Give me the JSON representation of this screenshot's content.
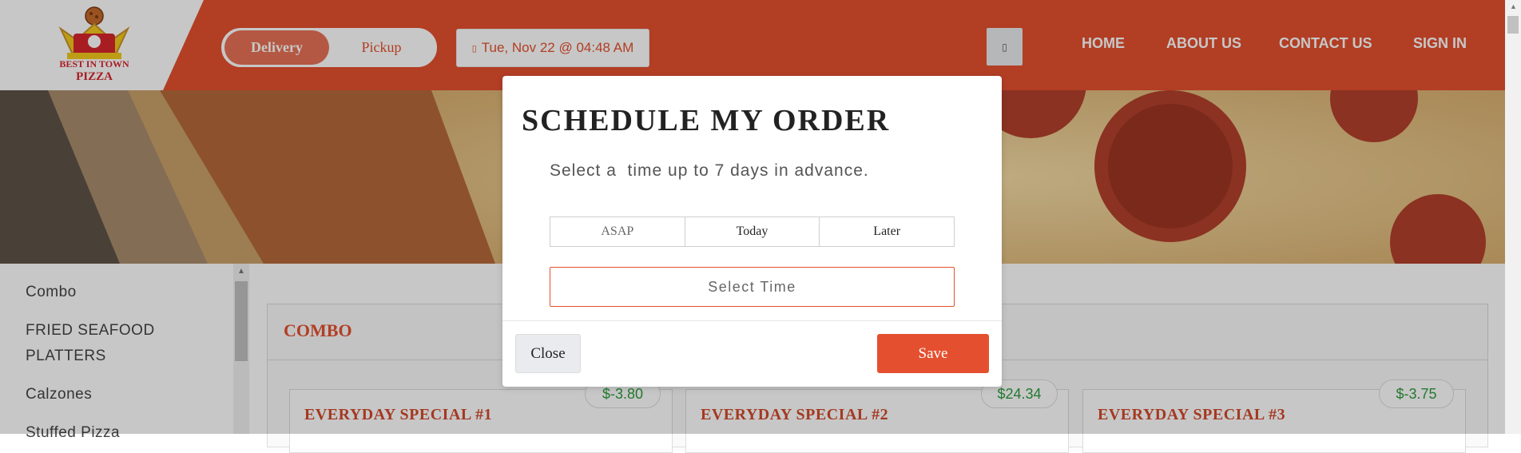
{
  "brand": {
    "line1": "BEST IN TOWN",
    "line2": "PIZZA"
  },
  "header": {
    "delivery_label": "Delivery",
    "pickup_label": "Pickup",
    "active_mode": "Delivery",
    "datetime_icon": "calendar-icon",
    "datetime_label": "Tue, Nov 22 @ 04:48 AM",
    "cart_icon": "cart-icon",
    "nav": [
      "HOME",
      "ABOUT US",
      "CONTACT US",
      "SIGN IN"
    ]
  },
  "sidebar": {
    "items": [
      "Combo",
      "FRIED SEAFOOD",
      "PLATTERS",
      "Calzones",
      "Stuffed Pizza"
    ]
  },
  "menu": {
    "section_title": "COMBO",
    "items": [
      {
        "title": "EVERYDAY SPECIAL #1",
        "price": "$-3.80"
      },
      {
        "title": "EVERYDAY SPECIAL #2",
        "price": "$24.34"
      },
      {
        "title": "EVERYDAY SPECIAL #3",
        "price": "$-3.75"
      }
    ]
  },
  "modal": {
    "title": "SCHEDULE MY ORDER",
    "subtitle": "Select a  time up to 7 days in advance.",
    "options": [
      "ASAP",
      "Today",
      "Later"
    ],
    "time_placeholder": "Select Time",
    "close_label": "Close",
    "save_label": "Save"
  },
  "colors": {
    "brand": "#e4502f",
    "price_green": "#2e9b3e"
  }
}
